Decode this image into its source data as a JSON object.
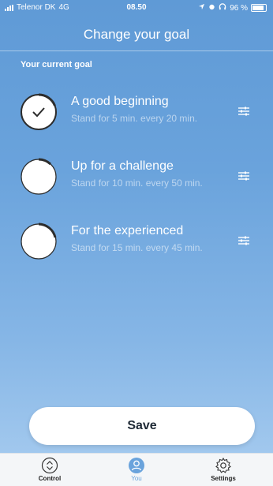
{
  "status_bar": {
    "carrier": "Telenor DK",
    "network": "4G",
    "time": "08.50",
    "battery": "96 %"
  },
  "header": {
    "title": "Change your goal"
  },
  "section": {
    "label": "Your current goal"
  },
  "goals": [
    {
      "title": "A good beginning",
      "subtitle": "Stand for 5 min. every 20 min.",
      "selected": true
    },
    {
      "title": "Up for a challenge",
      "subtitle": "Stand for 10 min. every 50 min.",
      "selected": false
    },
    {
      "title": "For the experienced",
      "subtitle": "Stand for 15 min. every 45 min.",
      "selected": false
    }
  ],
  "save_label": "Save",
  "tabbar": {
    "items": [
      {
        "label": "Control",
        "icon": "chevron-updown-icon",
        "active": false
      },
      {
        "label": "You",
        "icon": "user-icon",
        "active": true
      },
      {
        "label": "Settings",
        "icon": "gear-icon",
        "active": false
      }
    ]
  },
  "colors": {
    "background_top": "#5f9ad6",
    "background_bottom": "#a9cdf0",
    "accent": "#6aa3dc",
    "text": "#ffffff"
  }
}
